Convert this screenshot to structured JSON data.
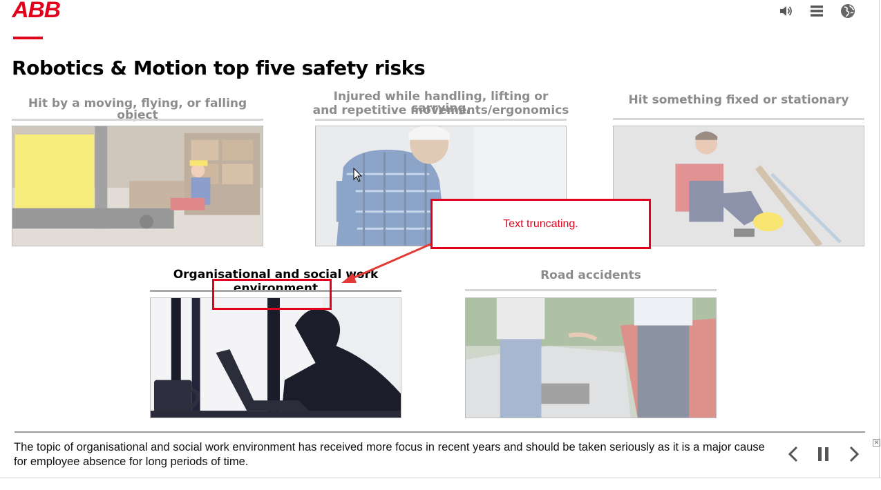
{
  "header": {
    "logo_text": "ABB",
    "icons": [
      "volume-icon",
      "menu-icon",
      "globe-icon"
    ]
  },
  "page_title": "Robotics & Motion top five safety risks",
  "cards": [
    {
      "title": "Hit by a moving, flying, or falling object",
      "image": "forklift-worker-photo",
      "active": false
    },
    {
      "title_line1": "Injured while handling, lifting or carrying,",
      "title_line2": "and repetitive movements/ergonomics",
      "image": "back-pain-worker-photo",
      "active": false
    },
    {
      "title": "Hit something fixed or stationary",
      "image": "injured-knee-worker-photo",
      "active": false
    },
    {
      "title_line1": "Organisational and social work",
      "title_line2": "environment",
      "image": "stressed-laptop-worker-photo",
      "active": true
    },
    {
      "title": "Road accidents",
      "image": "car-crash-photo",
      "active": false
    }
  ],
  "annotation": {
    "callout_text": "Text truncating."
  },
  "footer": {
    "caption": "The topic of organisational and social work environment has received more focus in recent years and should be taken seriously as it is a major cause for employee absence for long periods of time.",
    "close_label": "✕"
  },
  "colors": {
    "brand": "#e2001a",
    "inactive_title": "#8c8c8c",
    "active_title": "#000000"
  }
}
